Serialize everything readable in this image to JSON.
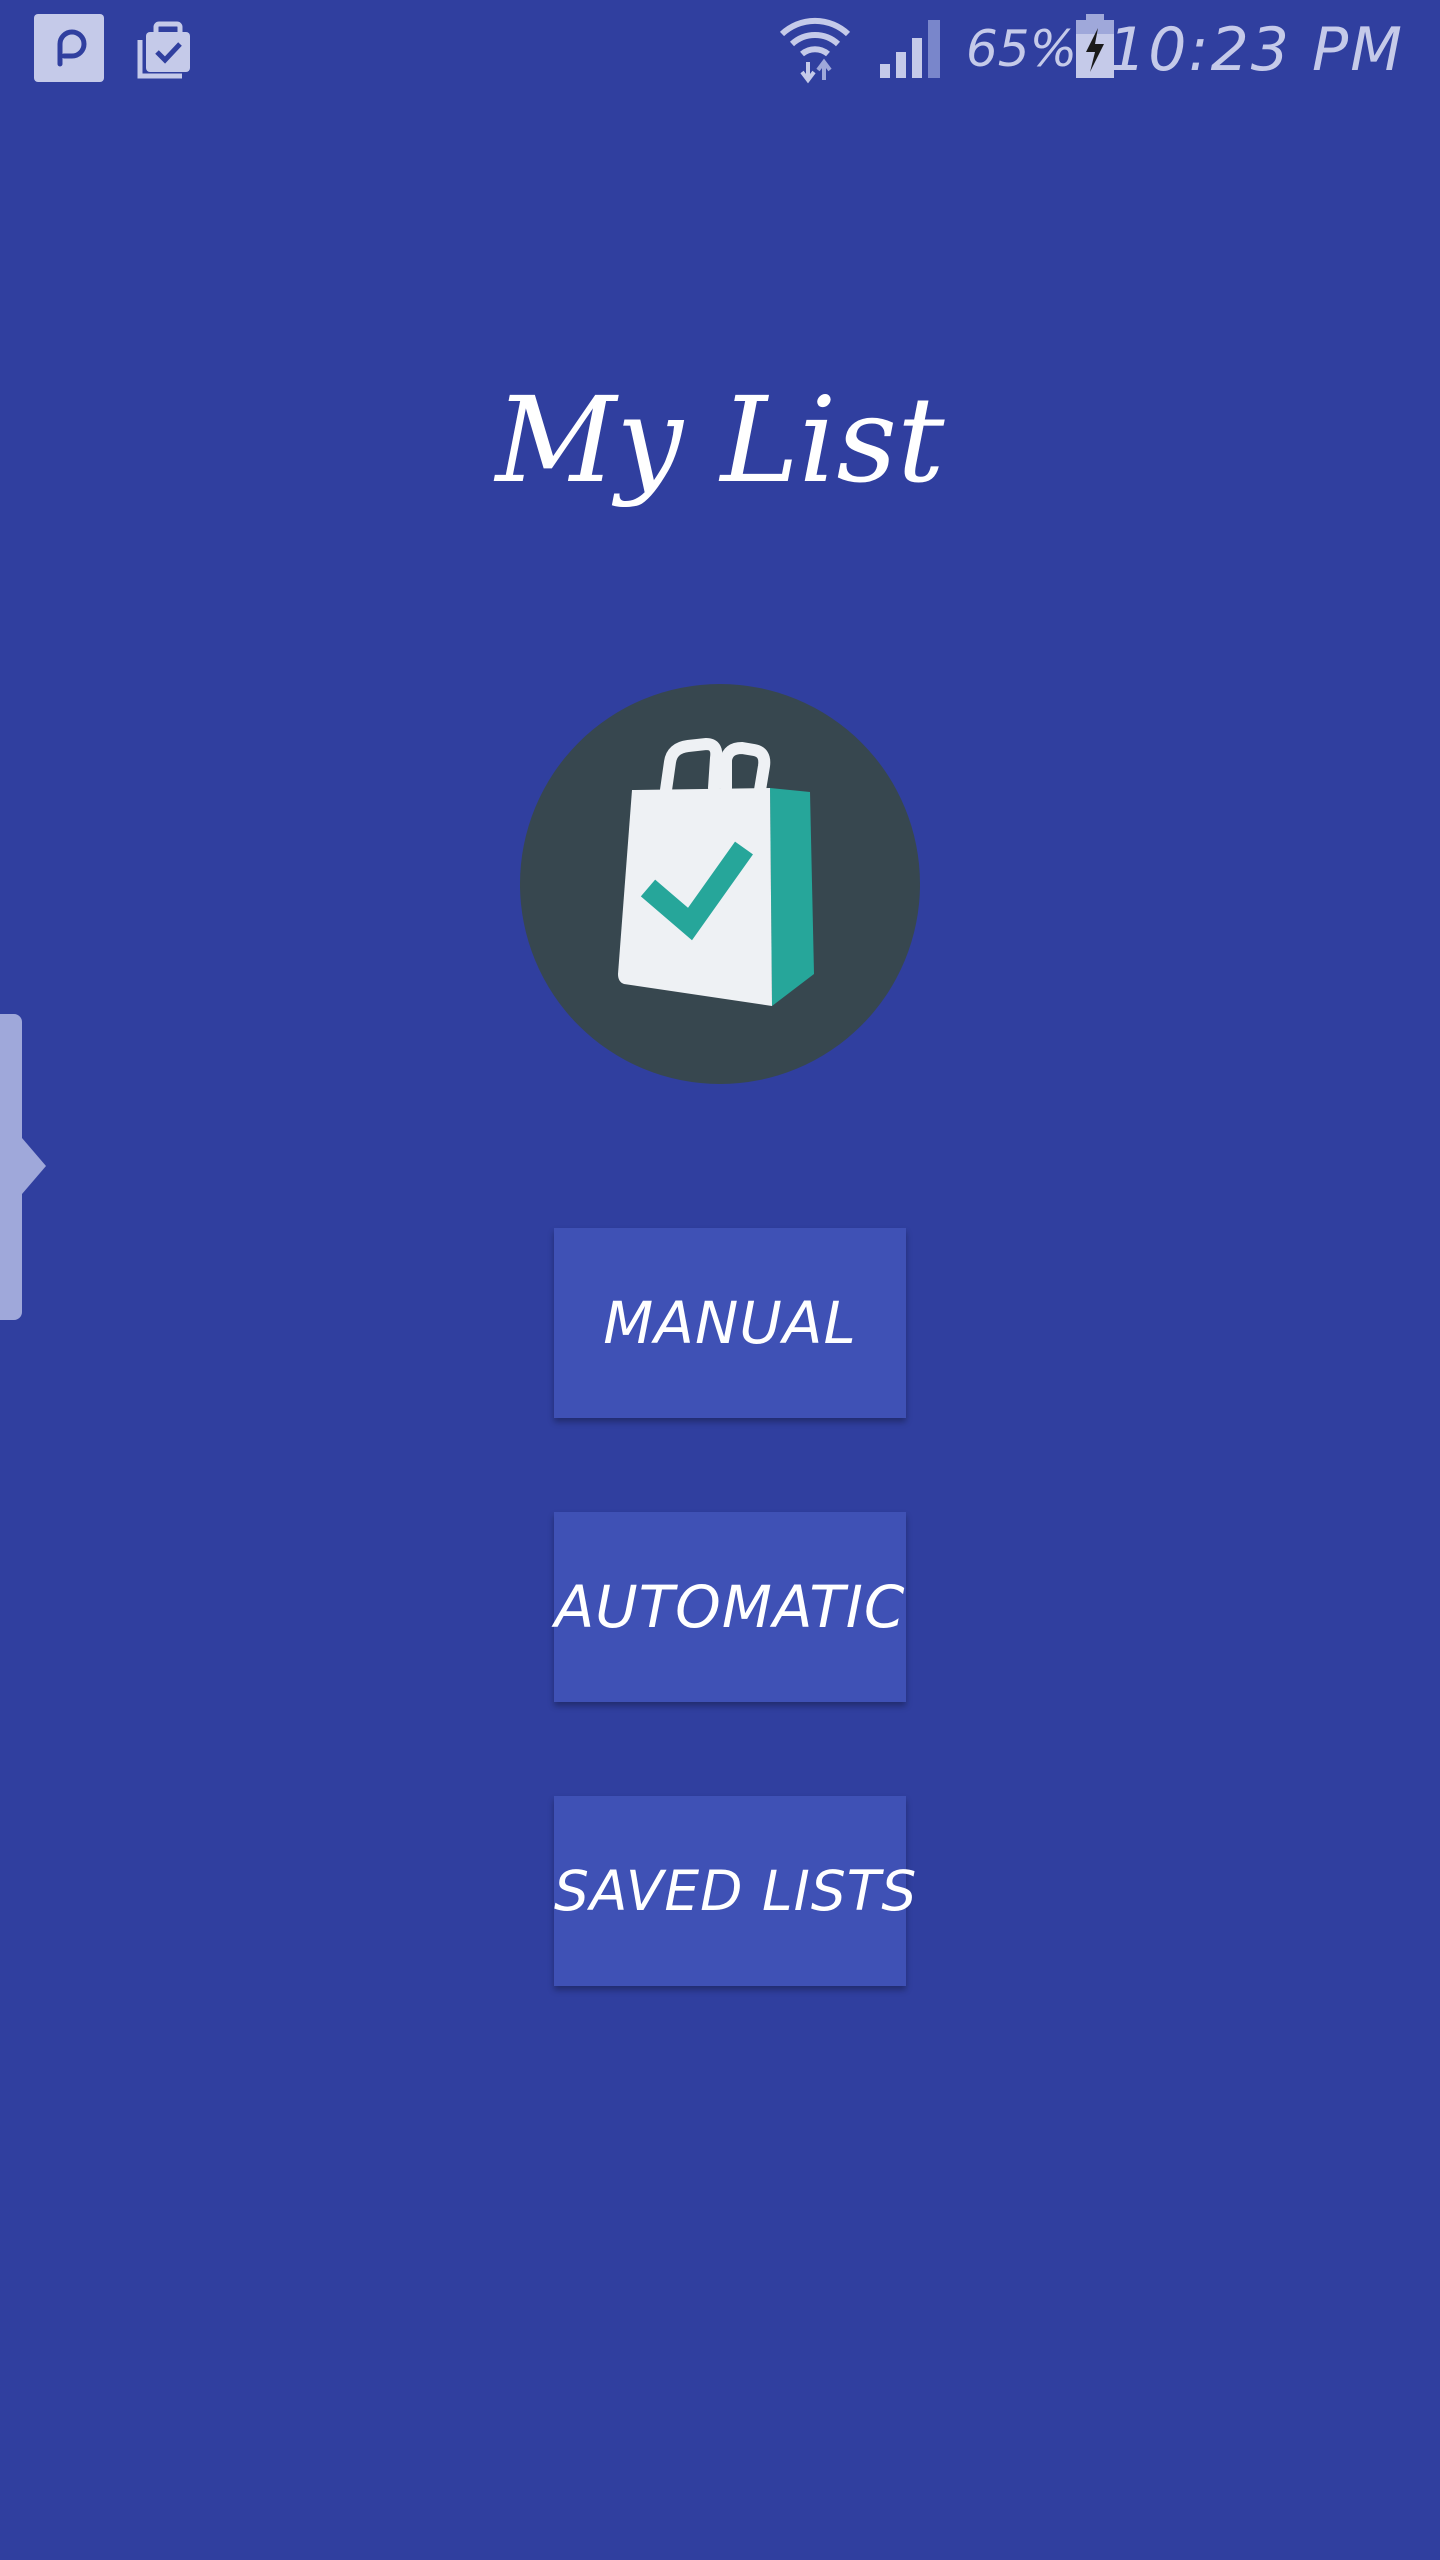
{
  "status_bar": {
    "battery_percent": "65%",
    "time": "10:23 PM",
    "icons": [
      "search-notification-icon",
      "task-notification-icon",
      "wifi-icon",
      "cell-signal-icon",
      "battery-charging-icon"
    ]
  },
  "app": {
    "title": "My List",
    "logo_icon": "shopping-bag-check-icon"
  },
  "buttons": {
    "manual": "MANUAL",
    "automatic": "AUTOMATIC",
    "saved_lists": "SAVED LISTS"
  },
  "colors": {
    "background": "#303f9f",
    "button": "#3f51b5",
    "logo_circle": "#37474f",
    "accent_teal": "#26a69a",
    "status_icons": "#c5cae9"
  }
}
